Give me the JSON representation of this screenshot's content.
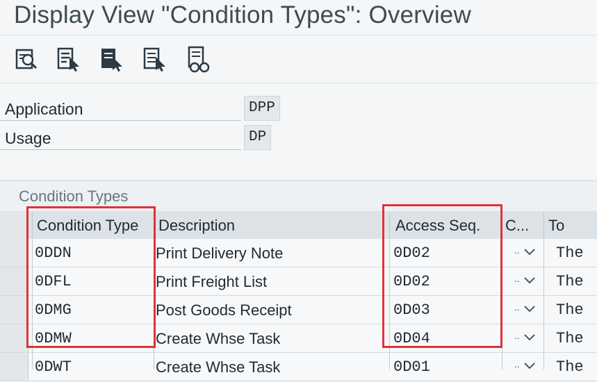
{
  "window": {
    "title": "Display View \"Condition Types\": Overview"
  },
  "toolbar": {
    "buttons": [
      {
        "icon": "find-icon"
      },
      {
        "icon": "select-all-icon"
      },
      {
        "icon": "select-block-icon"
      },
      {
        "icon": "deselect-all-icon"
      },
      {
        "icon": "print-icon"
      }
    ]
  },
  "fields": {
    "application": {
      "label": "Application",
      "value": "DPP"
    },
    "usage": {
      "label": "Usage",
      "value": "DP"
    }
  },
  "table": {
    "caption": "Condition Types",
    "columns": [
      "Condition Type",
      "Description",
      "Access Seq.",
      "C...",
      "To"
    ],
    "rows": [
      {
        "condition_type": "0DDN",
        "description": "Print Delivery Note",
        "access_seq": "0D02",
        "c": "",
        "to": "The"
      },
      {
        "condition_type": "0DFL",
        "description": "Print Freight List",
        "access_seq": "0D02",
        "c": "",
        "to": "The"
      },
      {
        "condition_type": "0DMG",
        "description": "Post Goods Receipt",
        "access_seq": "0D03",
        "c": "",
        "to": "The"
      },
      {
        "condition_type": "0DMW",
        "description": "Create Whse Task",
        "access_seq": "0D04",
        "c": "",
        "to": "The"
      },
      {
        "condition_type": "0DWT",
        "description": "Create Whse Task",
        "access_seq": "0D01",
        "c": "",
        "to": "The"
      }
    ]
  },
  "colors": {
    "highlight": "#e0313a"
  }
}
